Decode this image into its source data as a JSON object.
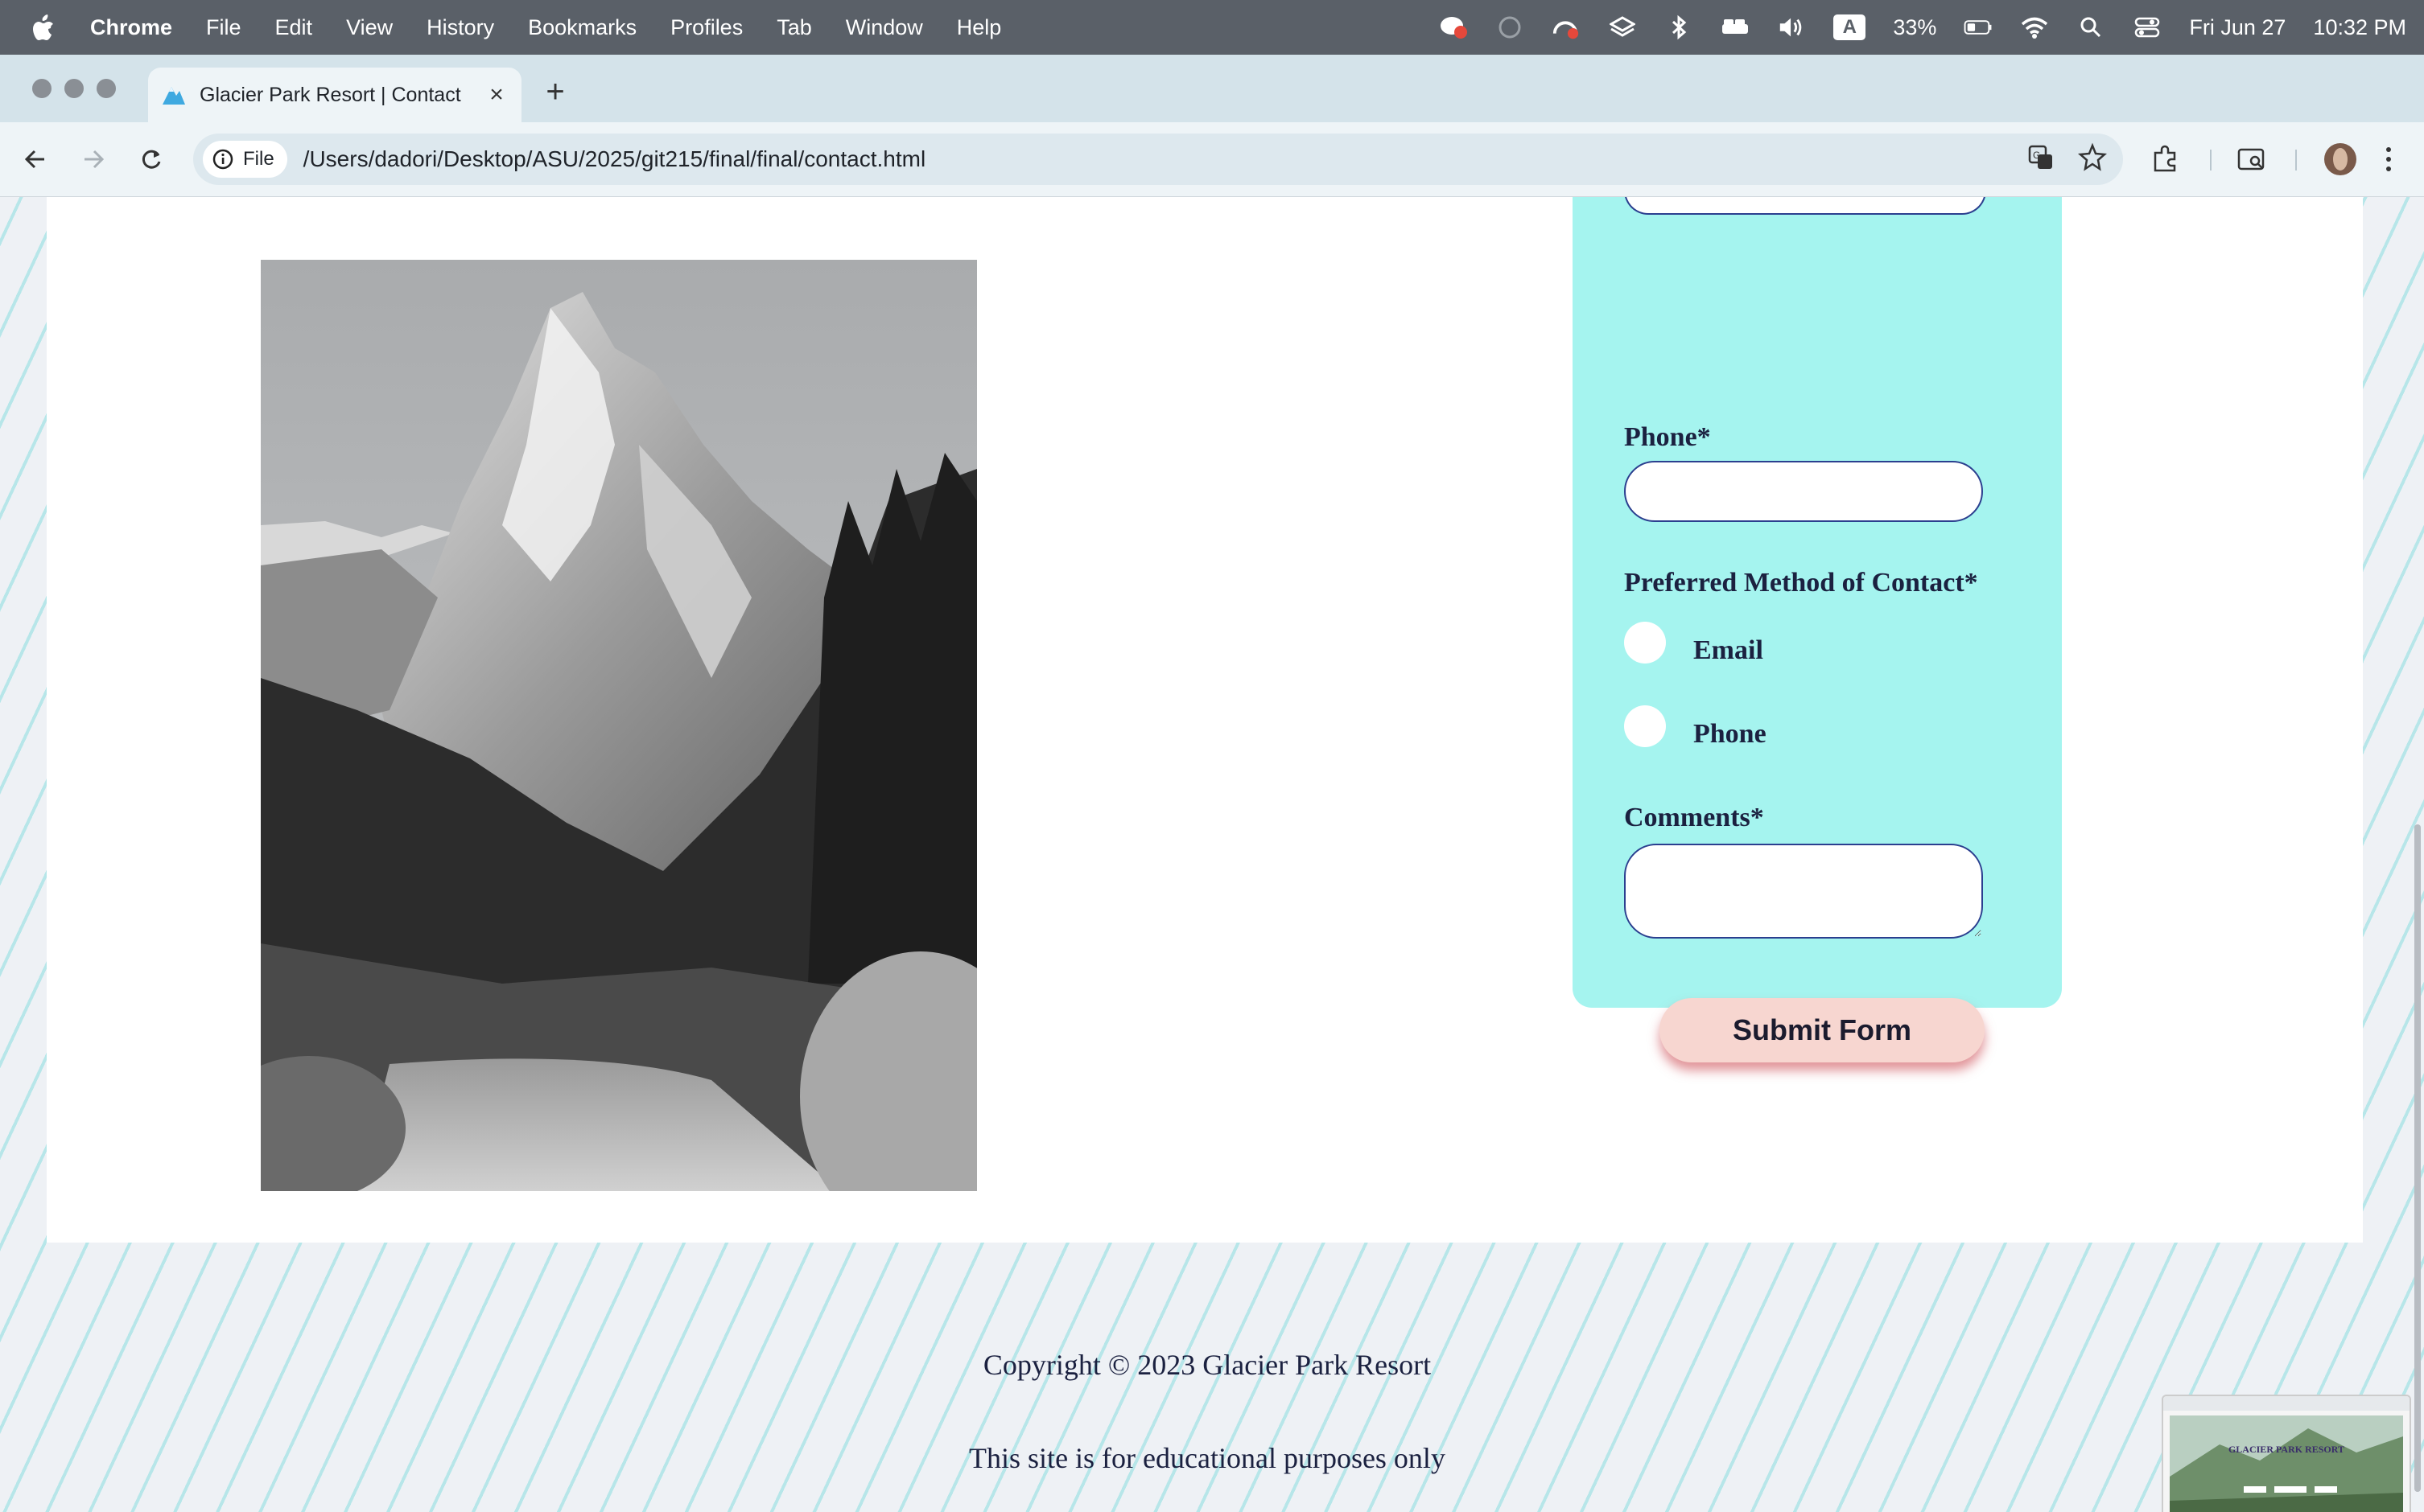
{
  "menubar": {
    "app_name": "Chrome",
    "items": [
      "File",
      "Edit",
      "View",
      "History",
      "Bookmarks",
      "Profiles",
      "Tab",
      "Window",
      "Help"
    ],
    "input_source": "A",
    "battery": "33%",
    "date": "Fri Jun 27",
    "time": "10:32 PM"
  },
  "browser": {
    "tab_title": "Glacier Park Resort | Contact",
    "omnibox_chip": "File",
    "url": "/Users/dadori/Desktop/ASU/2025/git215/final/final/contact.html"
  },
  "form": {
    "phone_label": "Phone*",
    "contact_method_label": "Preferred Method of Contact*",
    "options": [
      "Email",
      "Phone"
    ],
    "comments_label": "Comments*",
    "submit_label": "Submit Form"
  },
  "footer": {
    "copyright": "Copyright © 2023 Glacier Park Resort",
    "disclaimer": "This site is for educational purposes only"
  },
  "thumbnail": {
    "title": "GLACIER PARK RESORT"
  },
  "colors": {
    "form_panel": "#a5f4ef",
    "submit_button": "#f7d6d0",
    "input_border": "#2b3f8f",
    "label_text": "#1b2140"
  }
}
